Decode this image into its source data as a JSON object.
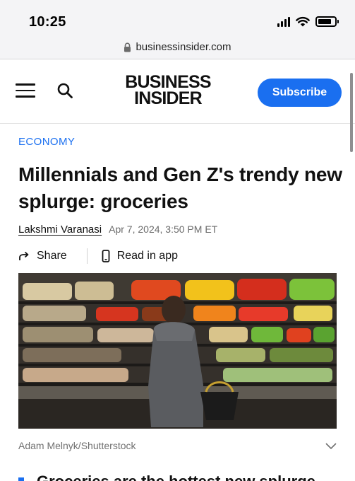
{
  "status_bar": {
    "time": "10:25",
    "icons": [
      "cellular-signal-icon",
      "wifi-icon",
      "battery-icon"
    ]
  },
  "browser": {
    "url": "businessinsider.com",
    "url_icon": "lock-icon"
  },
  "header": {
    "menu_icon": "hamburger-menu-icon",
    "search_icon": "search-icon",
    "logo_line1": "BUSINESS",
    "logo_line2": "INSIDER",
    "subscribe_label": "Subscribe"
  },
  "article": {
    "category": "ECONOMY",
    "headline": "Millennials and Gen Z's trendy new splurge: groceries",
    "author": "Lakshmi Varanasi",
    "date": "Apr 7, 2024, 3:50 PM ET",
    "actions": {
      "share_label": "Share",
      "share_icon": "share-arrow-icon",
      "read_in_app_label": "Read in app",
      "read_in_app_icon": "phone-icon"
    },
    "image_caption": "Adam Melnyk/Shutterstock",
    "caption_toggle_icon": "chevron-down-icon",
    "summary_first_bullet": "Groceries are the hottest new splurge"
  },
  "colors": {
    "accent": "#1a6ff0",
    "text": "#111111",
    "muted": "#6b6b6b",
    "chrome": "#f4f4f6"
  }
}
